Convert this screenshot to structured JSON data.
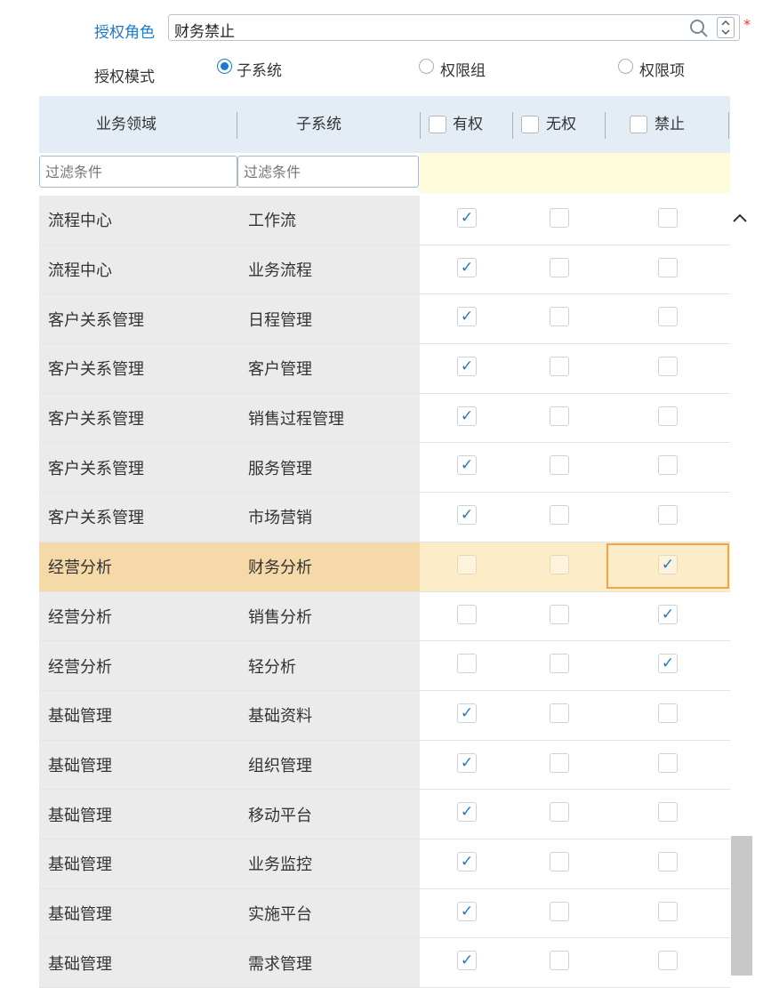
{
  "form": {
    "role_label": "授权角色",
    "role_value": "财务禁止",
    "required_mark": "*",
    "mode_label": "授权模式",
    "modes": [
      {
        "label": "子系统",
        "selected": true
      },
      {
        "label": "权限组",
        "selected": false
      },
      {
        "label": "权限项",
        "selected": false
      }
    ]
  },
  "grid": {
    "columns": {
      "domain": "业务领域",
      "subsystem": "子系统",
      "allow": "有权",
      "none": "无权",
      "deny": "禁止"
    },
    "filter_placeholder": "过滤条件",
    "rows": [
      {
        "domain": "流程中心",
        "subsystem": "工作流",
        "allow": true,
        "none": false,
        "deny": false
      },
      {
        "domain": "流程中心",
        "subsystem": "业务流程",
        "allow": true,
        "none": false,
        "deny": false
      },
      {
        "domain": "客户关系管理",
        "subsystem": "日程管理",
        "allow": true,
        "none": false,
        "deny": false
      },
      {
        "domain": "客户关系管理",
        "subsystem": "客户管理",
        "allow": true,
        "none": false,
        "deny": false
      },
      {
        "domain": "客户关系管理",
        "subsystem": "销售过程管理",
        "allow": true,
        "none": false,
        "deny": false
      },
      {
        "domain": "客户关系管理",
        "subsystem": "服务管理",
        "allow": true,
        "none": false,
        "deny": false
      },
      {
        "domain": "客户关系管理",
        "subsystem": "市场营销",
        "allow": true,
        "none": false,
        "deny": false
      },
      {
        "domain": "经营分析",
        "subsystem": "财务分析",
        "allow": false,
        "none": false,
        "deny": true,
        "selected": true
      },
      {
        "domain": "经营分析",
        "subsystem": "销售分析",
        "allow": false,
        "none": false,
        "deny": true
      },
      {
        "domain": "经营分析",
        "subsystem": "轻分析",
        "allow": false,
        "none": false,
        "deny": true
      },
      {
        "domain": "基础管理",
        "subsystem": "基础资料",
        "allow": true,
        "none": false,
        "deny": false
      },
      {
        "domain": "基础管理",
        "subsystem": "组织管理",
        "allow": true,
        "none": false,
        "deny": false
      },
      {
        "domain": "基础管理",
        "subsystem": "移动平台",
        "allow": true,
        "none": false,
        "deny": false
      },
      {
        "domain": "基础管理",
        "subsystem": "业务监控",
        "allow": true,
        "none": false,
        "deny": false
      },
      {
        "domain": "基础管理",
        "subsystem": "实施平台",
        "allow": true,
        "none": false,
        "deny": false
      },
      {
        "domain": "基础管理",
        "subsystem": "需求管理",
        "allow": true,
        "none": false,
        "deny": false
      }
    ]
  },
  "colors": {
    "accent": "#1a7ad0",
    "header_bg": "#e4ecf5",
    "selected_row": "#fdecc8",
    "selected_cell_border": "#f0a54a",
    "required": "#e53935"
  }
}
